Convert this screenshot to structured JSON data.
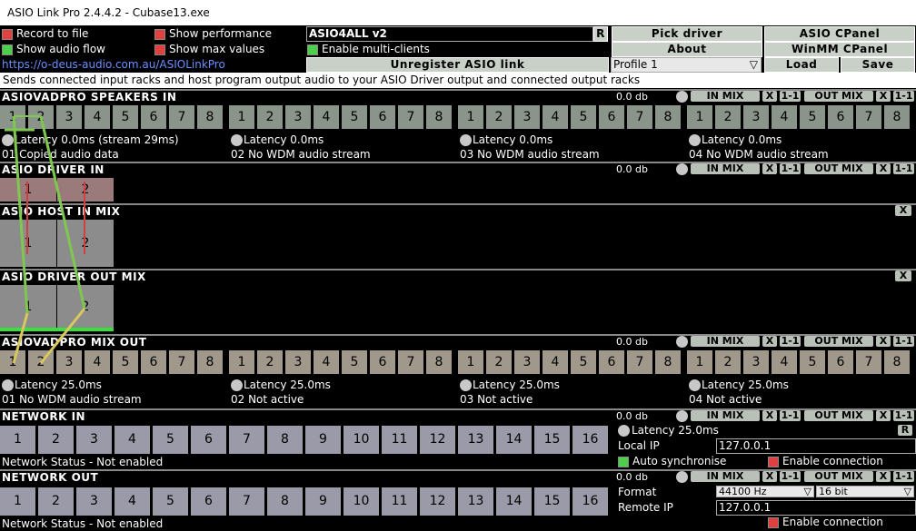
{
  "window": {
    "title": "ASIO Link Pro 2.4.4.2 - Cubase13.exe"
  },
  "options": {
    "record_to_file": "Record to file",
    "show_performance": "Show performance",
    "show_audio_flow": "Show audio flow",
    "show_max_values": "Show max values",
    "enable_multi_clients": "Enable multi-clients"
  },
  "header": {
    "driver_name": "ASIO4ALL v2",
    "reset": "R",
    "pick_driver": "Pick driver",
    "asio_cpanel": "ASIO CPanel",
    "about": "About",
    "winmm_cpanel": "WinMM CPanel",
    "unregister": "Unregister ASIO link",
    "profile": "Profile 1",
    "load": "Load",
    "save": "Save",
    "website": "https://o-deus-audio.com.au/ASIOLinkPro"
  },
  "info": "Sends connected input racks and host program output audio to your ASIO Driver output and connected output racks",
  "sections": {
    "speakers_in": {
      "title": "ASIOVADPRO SPEAKERS IN",
      "db": "0.0 db",
      "in_mix": "IN MIX",
      "out_mix": "OUT MIX",
      "x": "X",
      "one_one": "1-1",
      "channels": [
        "1",
        "2",
        "3",
        "4",
        "5",
        "6",
        "7",
        "8"
      ],
      "racks": [
        {
          "latency": "Latency 0.0ms (stream 29ms)",
          "status": "01 Copied audio data"
        },
        {
          "latency": "Latency 0.0ms",
          "status": "02 No WDM audio stream"
        },
        {
          "latency": "Latency 0.0ms",
          "status": "03 No WDM audio stream"
        },
        {
          "latency": "Latency 0.0ms",
          "status": "04 No WDM audio stream"
        }
      ]
    },
    "driver_in": {
      "title": "ASIO DRIVER IN",
      "db": "0.0 db",
      "in_mix": "IN MIX",
      "out_mix": "OUT MIX",
      "x": "X",
      "one_one": "1-1",
      "channels": [
        "1",
        "2"
      ]
    },
    "host_in_mix": {
      "title": "ASIO HOST IN MIX",
      "x": "X",
      "channels": [
        "1",
        "2"
      ]
    },
    "driver_out_mix": {
      "title": "ASIO DRIVER OUT MIX",
      "x": "X",
      "channels": [
        "1",
        "2"
      ]
    },
    "mix_out": {
      "title": "ASIOVADPRO MIX OUT",
      "db": "0.0 db",
      "in_mix": "IN MIX",
      "out_mix": "OUT MIX",
      "x": "X",
      "one_one": "1-1",
      "channels": [
        "1",
        "2",
        "3",
        "4",
        "5",
        "6",
        "7",
        "8"
      ],
      "racks": [
        {
          "latency": "Latency 25.0ms",
          "status": "01 No WDM audio stream"
        },
        {
          "latency": "Latency 25.0ms",
          "status": "02 Not active"
        },
        {
          "latency": "Latency 25.0ms",
          "status": "03 Not active"
        },
        {
          "latency": "Latency 25.0ms",
          "status": "04 Not active"
        }
      ]
    },
    "network_in": {
      "title": "NETWORK IN",
      "db": "0.0 db",
      "in_mix": "IN MIX",
      "out_mix": "OUT MIX",
      "x": "X",
      "one_one": "1-1",
      "channels": [
        "1",
        "2",
        "3",
        "4",
        "5",
        "6",
        "7",
        "8",
        "9",
        "10",
        "11",
        "12",
        "13",
        "14",
        "15",
        "16"
      ],
      "status": "Network Status - Not enabled",
      "latency": "Latency 25.0ms",
      "reset": "R",
      "local_ip_label": "Local IP",
      "local_ip": "127.0.0.1",
      "auto_sync": "Auto synchronise",
      "enable_connection": "Enable connection"
    },
    "network_out": {
      "title": "NETWORK OUT",
      "db": "0.0 db",
      "in_mix": "IN MIX",
      "out_mix": "OUT MIX",
      "x": "X",
      "one_one": "1-1",
      "channels": [
        "1",
        "2",
        "3",
        "4",
        "5",
        "6",
        "7",
        "8",
        "9",
        "10",
        "11",
        "12",
        "13",
        "14",
        "15",
        "16"
      ],
      "status": "Network Status - Not enabled",
      "format_label": "Format",
      "sample_rate": "44100 Hz",
      "bit_depth": "16 bit",
      "remote_ip_label": "Remote IP",
      "remote_ip": "127.0.0.1",
      "enable_connection": "Enable connection"
    }
  },
  "colors": {
    "cell_green": "#8a948a",
    "cell_tan": "#a0988a",
    "cell_network": "#9a9aa8",
    "wire_green": "#7ec850",
    "wire_yellow": "#d8c860",
    "wire_red": "#d04040"
  }
}
